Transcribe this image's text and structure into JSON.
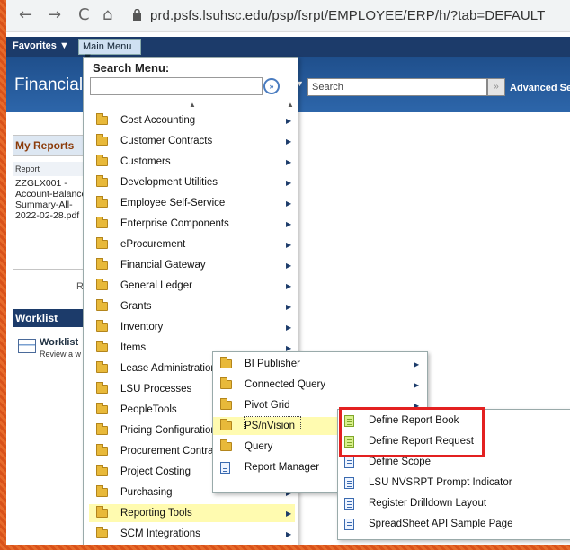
{
  "browser": {
    "url": "prd.psfs.lsuhsc.edu/psp/fsrpt/EMPLOYEE/ERP/h/?tab=DEFAULT",
    "back_icon": "←",
    "forward_icon": "→",
    "reload_icon": "C",
    "home_icon": "⌂"
  },
  "nav": {
    "favorites": "Favorites ▼",
    "main_menu": "Main Menu ▼"
  },
  "header": {
    "title": "Financials",
    "search_placeholder": "Search",
    "go_label": "»",
    "advanced_search": "Advanced Sear"
  },
  "my_reports": {
    "title": "My Reports",
    "column": "Report",
    "report_name": "ZZGLX001 - Account-Balance-Summary-All-2022-02-28.pdf",
    "more_label": "R"
  },
  "worklist": {
    "title": "Worklist",
    "label": "Worklist",
    "desc": "Review a w"
  },
  "main_menu": {
    "search_label": "Search Menu:",
    "search_go": "»",
    "items": [
      "Cost Accounting",
      "Customer Contracts",
      "Customers",
      "Development Utilities",
      "Employee Self-Service",
      "Enterprise Components",
      "eProcurement",
      "Financial Gateway",
      "General Ledger",
      "Grants",
      "Inventory",
      "Items",
      "Lease Administration",
      "LSU Processes",
      "PeopleTools",
      "Pricing Configuration",
      "Procurement Contracts",
      "Project Costing",
      "Purchasing",
      "Reporting Tools",
      "SCM Integrations"
    ]
  },
  "reporting_tools_menu": {
    "items": [
      "BI Publisher",
      "Connected Query",
      "Pivot Grid",
      "PS/nVision",
      "Query",
      "Report Manager"
    ]
  },
  "psnvision_menu": {
    "items": [
      "Define Report Book",
      "Define Report Request",
      "Define Scope",
      "LSU NVSRPT Prompt Indicator",
      "Register Drilldown Layout",
      "SpreadSheet API Sample Page"
    ]
  },
  "colors": {
    "nav_bar": "#1c3b6a",
    "highlight": "#fffbb0",
    "callout": "#e32020"
  }
}
